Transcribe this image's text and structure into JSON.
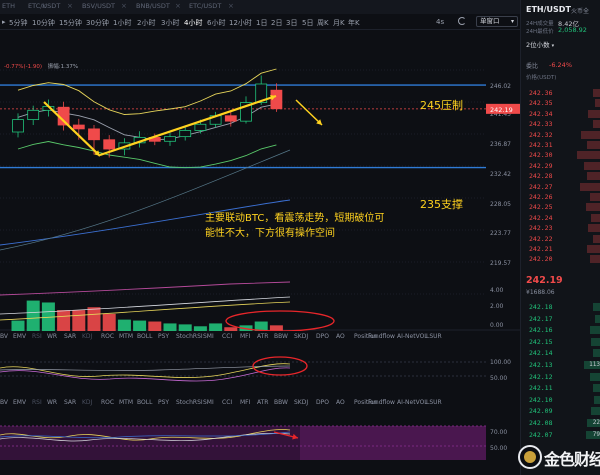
{
  "top_tabs": [
    {
      "label": "ETH"
    },
    {
      "label": "ETC/USDT"
    },
    {
      "label": "BSV/USDT"
    },
    {
      "label": "BNB/USDT"
    },
    {
      "label": "ETC/USDT"
    }
  ],
  "intervals": [
    {
      "label": "5分钟"
    },
    {
      "label": "10分钟"
    },
    {
      "label": "15分钟"
    },
    {
      "label": "30分钟"
    },
    {
      "label": "1小时"
    },
    {
      "label": "2小时"
    },
    {
      "label": "3小时"
    },
    {
      "label": "4小时",
      "active": true
    },
    {
      "label": "6小时"
    },
    {
      "label": "12小时"
    },
    {
      "label": "1日"
    },
    {
      "label": "2日"
    },
    {
      "label": "3日"
    },
    {
      "label": "5日"
    },
    {
      "label": "周K"
    },
    {
      "label": "月K"
    },
    {
      "label": "年K"
    }
  ],
  "toolbar": {
    "refresh_label": "4s",
    "currency": "单窗口"
  },
  "legend": {
    "line1": [
      "-0.77%(-1.90)",
      "振幅:1.37%"
    ]
  },
  "price_axis": {
    "ticks": [
      "246.02",
      "241.45",
      "236.87",
      "232.42",
      "228.05",
      "223.77",
      "219.57"
    ],
    "current": "242.19",
    "volume_ticks": [
      "4.00",
      "2.00",
      "0.00"
    ],
    "osc1_ticks": [
      "100.00",
      "50.00"
    ],
    "osc2_ticks": [
      "70.00",
      "50.00"
    ]
  },
  "annotations": {
    "resistance": "245压制",
    "support": "235支撑",
    "comment": "主要联动BTC，看震荡走势，短期破位可能性不大，下方很有操作空间"
  },
  "indicator_tabs_1": [
    "BV",
    "EMV",
    "RSI",
    "WR",
    "SAR",
    "KDJ",
    "ROC",
    "MTM",
    "BOLL",
    "PSY",
    "StochRSI",
    "SMI",
    "CCI",
    "MFI",
    "ATR",
    "BBW",
    "BIAS",
    "SKDJ",
    "BIAS",
    "DPO",
    "AO",
    "Position",
    "Fundflow",
    "AI-NetVOL",
    "LSUR"
  ],
  "indicator_tabs_2": [
    "BV",
    "EMV",
    "RSI",
    "WR",
    "SAR",
    "KDJ",
    "ROC",
    "MTM",
    "BOLL",
    "PSY",
    "StochRSI",
    "SMI",
    "CCI",
    "MFI",
    "ATR",
    "BBW",
    "BIAS",
    "SKDJ",
    "BIAS",
    "DPO",
    "AO",
    "Position",
    "Fundflow",
    "AI-NetVOL",
    "LSUR"
  ],
  "right_panel": {
    "symbol": "ETH/USDT",
    "exchange": "火币全",
    "vol_label": "24H成交量",
    "vol_value": "8.42亿",
    "low_label": "24H最低价",
    "low_value": "2,058.92",
    "precision": "2位小数",
    "rate_label": "委比",
    "rate_value": "-6.24%",
    "head_price": "价格(USDT)",
    "asks": [
      {
        "price": "242.36",
        "bar": 0.3
      },
      {
        "price": "242.35",
        "bar": 0.2
      },
      {
        "price": "242.34",
        "bar": 0.45
      },
      {
        "price": "242.33",
        "bar": 0.3
      },
      {
        "price": "242.32",
        "bar": 0.7
      },
      {
        "price": "242.31",
        "bar": 0.5
      },
      {
        "price": "242.30",
        "bar": 0.85
      },
      {
        "price": "242.29",
        "bar": 0.6
      },
      {
        "price": "242.28",
        "bar": 0.5
      },
      {
        "price": "242.27",
        "bar": 0.75
      },
      {
        "price": "242.26",
        "bar": 0.4
      },
      {
        "price": "242.25",
        "bar": 0.55
      },
      {
        "price": "242.24",
        "bar": 0.35
      },
      {
        "price": "242.23",
        "bar": 0.45
      },
      {
        "price": "242.22",
        "bar": 0.3
      },
      {
        "price": "242.21",
        "bar": 0.5
      },
      {
        "price": "242.20",
        "bar": 0.4
      }
    ],
    "last_price": "242.19",
    "last_cny": "¥1688.06",
    "bids": [
      {
        "price": "242.18",
        "bar": 0.3,
        "qty": ""
      },
      {
        "price": "242.17",
        "bar": 0.2,
        "qty": ""
      },
      {
        "price": "242.16",
        "bar": 0.4,
        "qty": ""
      },
      {
        "price": "242.15",
        "bar": 0.35,
        "qty": ""
      },
      {
        "price": "242.14",
        "bar": 0.3,
        "qty": ""
      },
      {
        "price": "242.13",
        "bar": 0.6,
        "qty": "113"
      },
      {
        "price": "242.12",
        "bar": 0.4,
        "qty": ""
      },
      {
        "price": "242.11",
        "bar": 0.3,
        "qty": ""
      },
      {
        "price": "242.10",
        "bar": 0.25,
        "qty": ""
      },
      {
        "price": "242.09",
        "bar": 0.35,
        "qty": ""
      },
      {
        "price": "242.08",
        "bar": 0.5,
        "qty": "22"
      },
      {
        "price": "242.07",
        "bar": 0.55,
        "qty": "79"
      }
    ]
  },
  "logo": {
    "text": "金色财经"
  },
  "colors": {
    "up": "#21c27a",
    "down": "#f04a4a",
    "accent": "#ffd21f",
    "band": "#2f7bd6"
  },
  "chart_data": {
    "type": "candlestick",
    "candles": [
      {
        "open": 239.2,
        "close": 240.8,
        "high": 241.6,
        "low": 238.5
      },
      {
        "open": 240.8,
        "close": 242.0,
        "high": 242.6,
        "low": 240.1
      },
      {
        "open": 242.0,
        "close": 242.5,
        "high": 243.4,
        "low": 241.2
      },
      {
        "open": 242.4,
        "close": 240.1,
        "high": 243.1,
        "low": 239.4
      },
      {
        "open": 240.1,
        "close": 239.6,
        "high": 240.9,
        "low": 238.2
      },
      {
        "open": 239.6,
        "close": 238.2,
        "high": 240.1,
        "low": 236.3
      },
      {
        "open": 238.2,
        "close": 237.0,
        "high": 238.8,
        "low": 235.9
      },
      {
        "open": 237.0,
        "close": 237.8,
        "high": 238.4,
        "low": 236.2
      },
      {
        "open": 237.8,
        "close": 238.5,
        "high": 239.3,
        "low": 237.2
      },
      {
        "open": 238.5,
        "close": 238.0,
        "high": 239.0,
        "low": 237.5
      },
      {
        "open": 238.0,
        "close": 238.6,
        "high": 239.1,
        "low": 237.4
      },
      {
        "open": 238.6,
        "close": 239.4,
        "high": 240.0,
        "low": 238.1
      },
      {
        "open": 239.4,
        "close": 240.2,
        "high": 240.8,
        "low": 239.0
      },
      {
        "open": 240.2,
        "close": 241.3,
        "high": 241.8,
        "low": 239.8
      },
      {
        "open": 241.3,
        "close": 240.6,
        "high": 242.0,
        "low": 239.9
      },
      {
        "open": 240.6,
        "close": 243.0,
        "high": 243.8,
        "low": 240.3
      },
      {
        "open": 243.0,
        "close": 245.4,
        "high": 246.5,
        "low": 242.7
      },
      {
        "open": 244.6,
        "close": 242.2,
        "high": 245.5,
        "low": 241.8
      }
    ],
    "volumes": [
      1.2,
      3.3,
      3.1,
      2.3,
      2.3,
      2.6,
      1.9,
      1.3,
      1.2,
      1.1,
      0.9,
      0.8,
      0.6,
      0.9,
      0.5,
      0.7,
      1.1,
      0.7
    ],
    "ylim": [
      217.5,
      248.5
    ],
    "resistance_level": 245,
    "support_level": 235
  }
}
